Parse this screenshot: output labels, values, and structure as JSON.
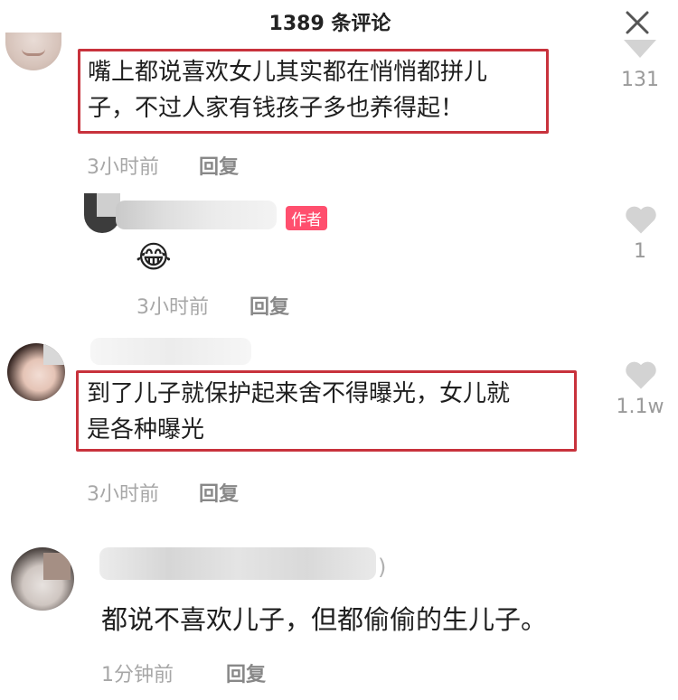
{
  "header": {
    "title": "1389 条评论",
    "close_icon": "close-icon"
  },
  "comments": [
    {
      "text_line1": "嘴上都说喜欢女儿其实都在悄悄都拼儿",
      "text_line2": "子，不过人家有钱孩子多也养得起！",
      "time": "3小时前",
      "reply_label": "回复",
      "likes": "131"
    },
    {
      "badge": "作者",
      "emoji": "😂",
      "time": "3小时前",
      "reply_label": "回复",
      "likes": "1"
    },
    {
      "text_line1": "到了儿子就保护起来舍不得曝光，女儿就",
      "text_line2": "是各种曝光",
      "time": "3小时前",
      "reply_label": "回复",
      "likes": "1.1w"
    },
    {
      "name_suffix": ")",
      "text_line1": "都说不喜欢儿子，但都偷偷的生儿子。",
      "time": "1分钟前",
      "reply_label": "回复"
    }
  ],
  "colors": {
    "highlight": "#c8323c",
    "badge": "#ff4f6e",
    "muted": "#a7a7a7"
  }
}
